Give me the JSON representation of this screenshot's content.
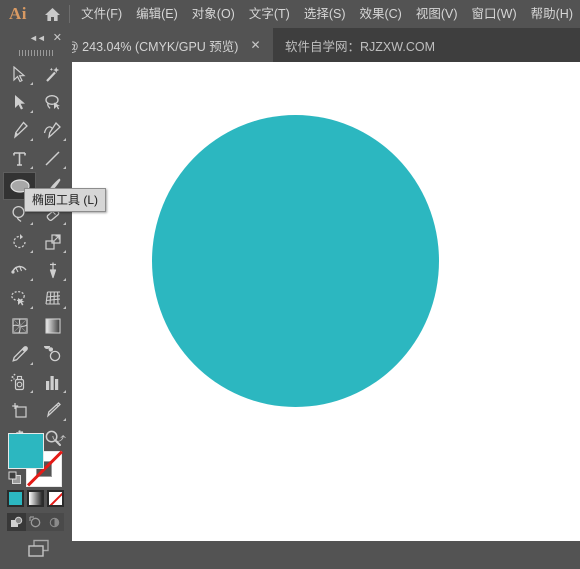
{
  "app": {
    "logo_text": "Ai",
    "home_icon": "home-icon"
  },
  "menubar": {
    "items": [
      {
        "label": "文件(F)",
        "name": "menu-file"
      },
      {
        "label": "编辑(E)",
        "name": "menu-edit"
      },
      {
        "label": "对象(O)",
        "name": "menu-object"
      },
      {
        "label": "文字(T)",
        "name": "menu-type"
      },
      {
        "label": "选择(S)",
        "name": "menu-select"
      },
      {
        "label": "效果(C)",
        "name": "menu-effect"
      },
      {
        "label": "视图(V)",
        "name": "menu-view"
      },
      {
        "label": "窗口(W)",
        "name": "menu-window"
      },
      {
        "label": "帮助(H)",
        "name": "menu-help"
      }
    ]
  },
  "tabbar": {
    "document_tab": {
      "label": "@ 243.04% (CMYK/GPU 预览)",
      "close_glyph": "✕",
      "zoom_level": "243.04%",
      "color_mode": "CMYK",
      "gpu_preview": "GPU 预览"
    },
    "watermark": {
      "label": "软件自学网：RJZXW.COM"
    }
  },
  "toolbar": {
    "collapse_glyph": "◄◄",
    "close_glyph": "✕",
    "tools": [
      {
        "name": "selection-tool",
        "icon": "arrow-outline-icon",
        "corner": true,
        "active": false
      },
      {
        "name": "magic-wand-tool",
        "icon": "magic-wand-icon",
        "corner": false,
        "active": false
      },
      {
        "name": "direct-selection-tool",
        "icon": "arrow-filled-icon",
        "corner": true,
        "active": false
      },
      {
        "name": "lasso-tool",
        "icon": "lasso-icon",
        "corner": false,
        "active": false
      },
      {
        "name": "pen-tool",
        "icon": "pen-icon",
        "corner": true,
        "active": false
      },
      {
        "name": "curvature-tool",
        "icon": "curvature-icon",
        "corner": true,
        "active": false
      },
      {
        "name": "type-tool",
        "icon": "type-t-icon",
        "corner": true,
        "active": false
      },
      {
        "name": "line-segment-tool",
        "icon": "line-segment-icon",
        "corner": true,
        "active": false
      },
      {
        "name": "ellipse-tool",
        "icon": "ellipse-icon",
        "corner": true,
        "active": true
      },
      {
        "name": "paintbrush-tool",
        "icon": "paintbrush-icon",
        "corner": true,
        "active": false
      },
      {
        "name": "shaper-tool",
        "icon": "shaper-icon",
        "corner": true,
        "active": false
      },
      {
        "name": "eraser-tool",
        "icon": "eraser-icon",
        "corner": true,
        "active": false
      },
      {
        "name": "rotate-tool",
        "icon": "rotate-icon",
        "corner": true,
        "active": false
      },
      {
        "name": "scale-tool",
        "icon": "scale-icon",
        "corner": true,
        "active": false
      },
      {
        "name": "width-tool",
        "icon": "width-icon",
        "corner": true,
        "active": false
      },
      {
        "name": "free-transform-tool",
        "icon": "pushpin-icon",
        "corner": true,
        "active": false
      },
      {
        "name": "shape-builder-tool",
        "icon": "shape-builder-icon",
        "corner": true,
        "active": false
      },
      {
        "name": "perspective-grid-tool",
        "icon": "perspective-grid-icon",
        "corner": true,
        "active": false
      },
      {
        "name": "mesh-tool",
        "icon": "mesh-icon",
        "corner": false,
        "active": false
      },
      {
        "name": "gradient-tool",
        "icon": "gradient-icon",
        "corner": false,
        "active": false
      },
      {
        "name": "eyedropper-tool",
        "icon": "eyedropper-icon",
        "corner": true,
        "active": false
      },
      {
        "name": "blend-tool",
        "icon": "blend-icon",
        "corner": false,
        "active": false
      },
      {
        "name": "symbol-sprayer-tool",
        "icon": "symbol-sprayer-icon",
        "corner": true,
        "active": false
      },
      {
        "name": "column-graph-tool",
        "icon": "bar-chart-icon",
        "corner": true,
        "active": false
      },
      {
        "name": "artboard-tool",
        "icon": "artboard-icon",
        "corner": false,
        "active": false
      },
      {
        "name": "slice-tool",
        "icon": "slice-knife-icon",
        "corner": true,
        "active": false
      },
      {
        "name": "hand-tool",
        "icon": "hand-icon",
        "corner": true,
        "active": false
      },
      {
        "name": "zoom-tool",
        "icon": "magnifier-icon",
        "corner": false,
        "active": false
      }
    ],
    "tooltip": {
      "label": "椭圆工具 (L)",
      "tool_name": "椭圆工具",
      "shortcut": "(L)"
    },
    "color_controls": {
      "fill_color": "#2cb7c0",
      "stroke_color": "none",
      "stroke_none_glyph": "none-slash",
      "swap_icon": "swap-fill-stroke-icon",
      "default_icon": "default-fill-stroke-icon",
      "fill_types": [
        {
          "name": "fill-type-color",
          "icon": "solid-color-icon",
          "active": true
        },
        {
          "name": "fill-type-gradient",
          "icon": "gradient-icon",
          "active": false
        },
        {
          "name": "fill-type-none",
          "icon": "none-icon",
          "active": false
        }
      ],
      "draw_modes": [
        {
          "name": "draw-normal-mode",
          "icon": "draw-normal-icon",
          "active": true
        },
        {
          "name": "draw-behind-mode",
          "icon": "draw-behind-icon",
          "active": false
        },
        {
          "name": "draw-inside-mode",
          "icon": "draw-inside-icon",
          "active": false
        }
      ],
      "screen_mode": {
        "name": "change-screen-mode",
        "icon": "screen-mode-icon"
      }
    }
  },
  "canvas": {
    "background": "#ffffff",
    "shape": {
      "name": "ellipse-shape",
      "type": "circle",
      "fill": "#2cb7c0",
      "stroke": "none"
    }
  }
}
